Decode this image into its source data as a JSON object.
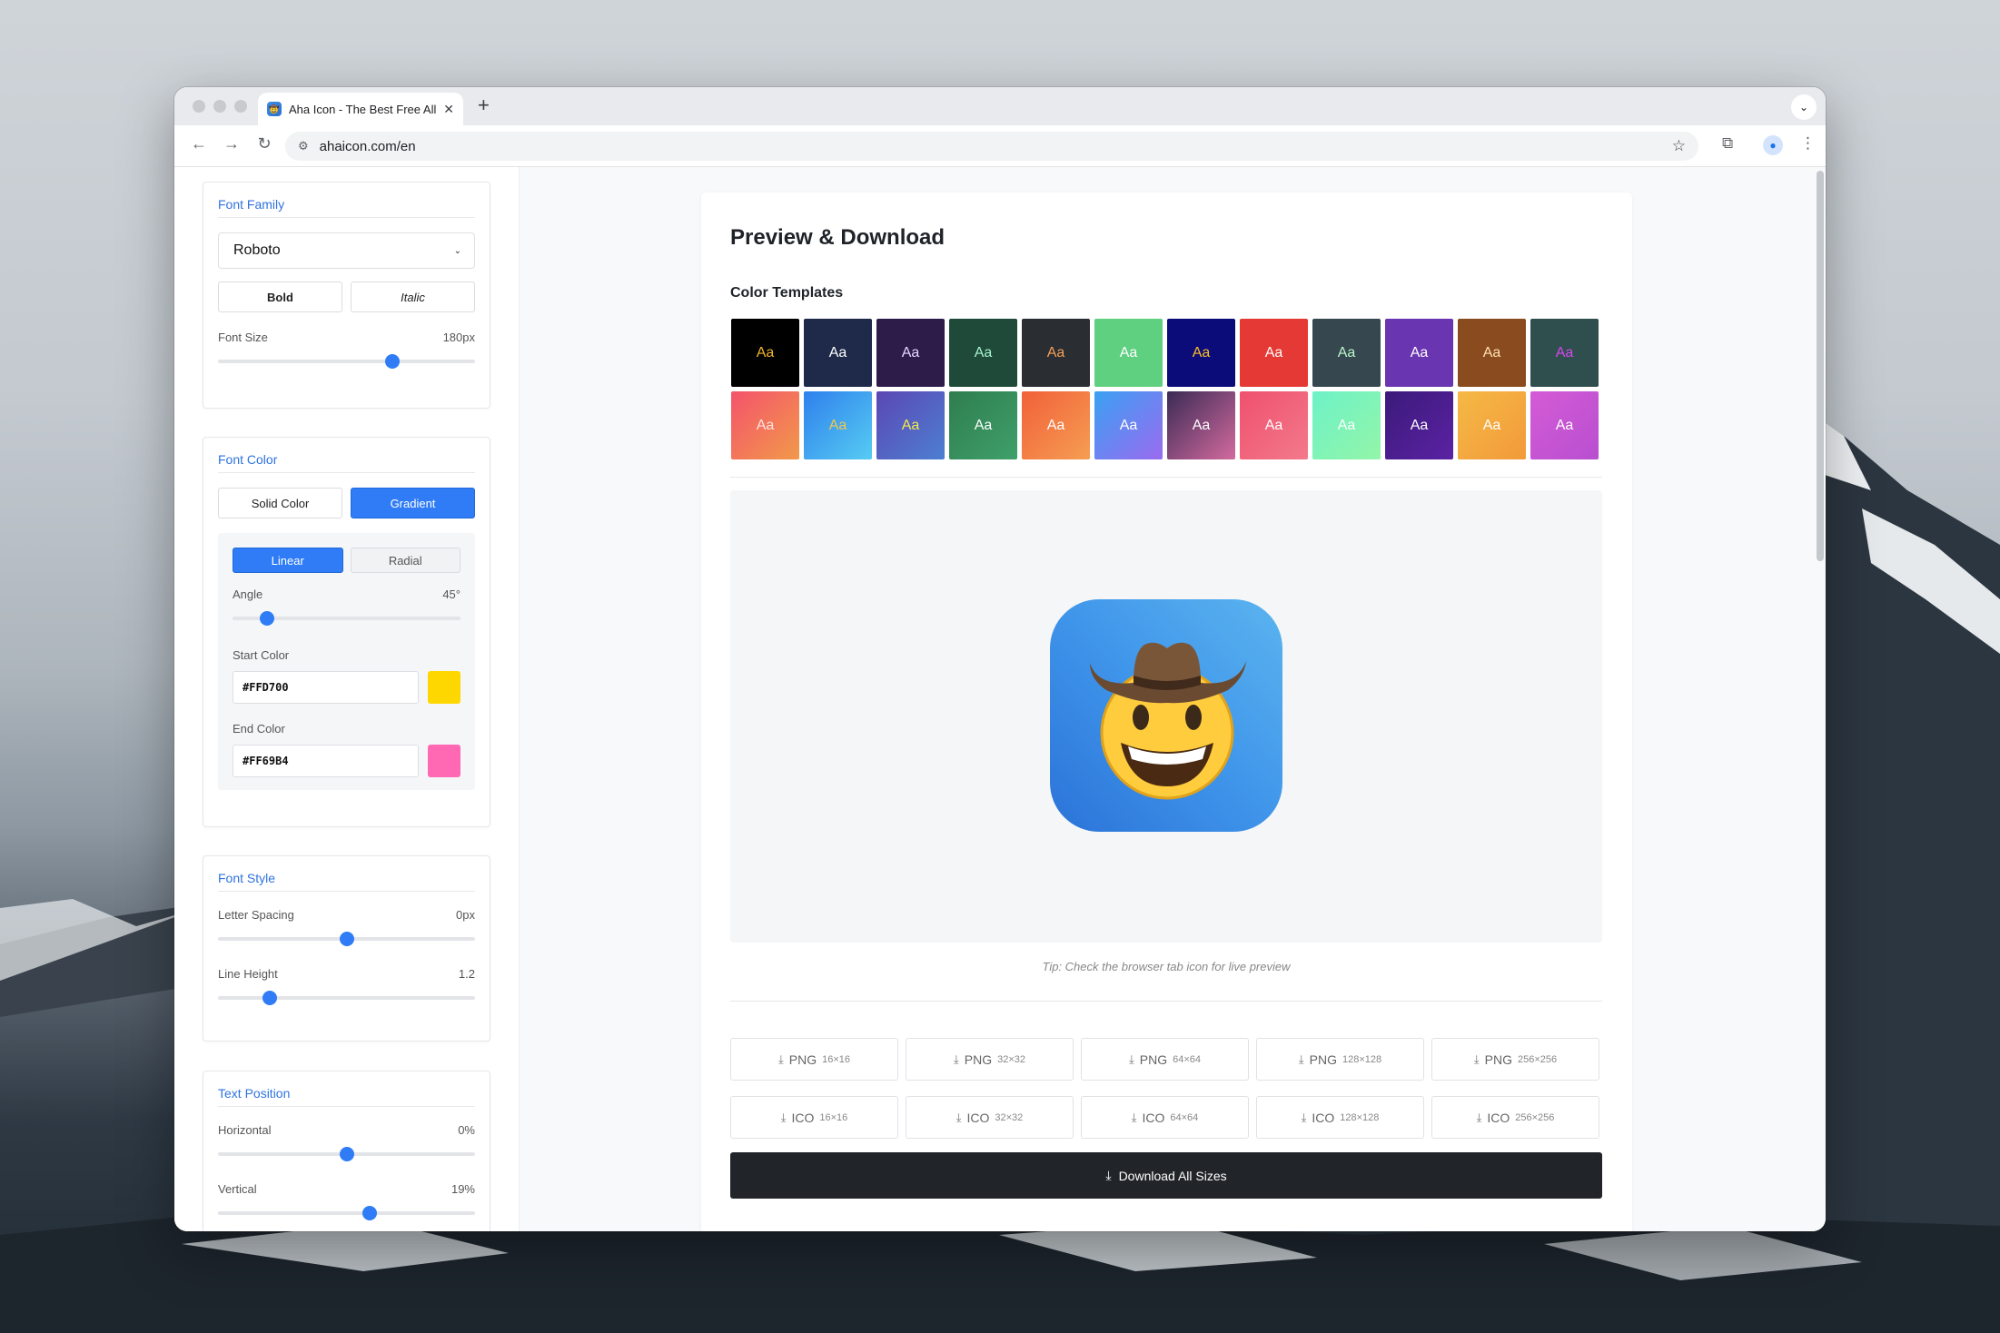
{
  "browser": {
    "tab_title": "Aha Icon - The Best Free All-in-One Icon Generator",
    "url": "ahaicon.com/en"
  },
  "sidebar": {
    "font_family": {
      "title": "Font Family",
      "selected": "Roboto",
      "bold_label": "Bold",
      "italic_label": "Italic",
      "font_size_label": "Font Size",
      "font_size_value": "180px",
      "font_size_fraction": 0.68
    },
    "font_color": {
      "title": "Font Color",
      "solid_label": "Solid Color",
      "gradient_label": "Gradient",
      "linear_label": "Linear",
      "radial_label": "Radial",
      "angle_label": "Angle",
      "angle_value": "45°",
      "angle_fraction": 0.15,
      "start_color_label": "Start Color",
      "start_color_value": "#FFD700",
      "end_color_label": "End Color",
      "end_color_value": "#FF69B4"
    },
    "font_style": {
      "title": "Font Style",
      "letter_spacing_label": "Letter Spacing",
      "letter_spacing_value": "0px",
      "letter_spacing_fraction": 0.5,
      "line_height_label": "Line Height",
      "line_height_value": "1.2",
      "line_height_fraction": 0.2
    },
    "text_position": {
      "title": "Text Position",
      "horizontal_label": "Horizontal",
      "horizontal_value": "0%",
      "horizontal_fraction": 0.5,
      "vertical_label": "Vertical",
      "vertical_value": "19%",
      "vertical_fraction": 0.59
    }
  },
  "main": {
    "title": "Preview & Download",
    "color_templates_title": "Color Templates",
    "template_label": "Aa",
    "templates": [
      {
        "bg": "#000000",
        "fg": "#f0b429"
      },
      {
        "bg": "#1f2a4a",
        "fg": "#ffffff"
      },
      {
        "bg": "#2d1b4a",
        "fg": "#e9d5ff"
      },
      {
        "bg": "#1f4a3a",
        "fg": "#a7f3d0"
      },
      {
        "bg": "#2a2d31",
        "fg": "#f5a05a"
      },
      {
        "bg": "#5fcf80",
        "fg": "#ffffff"
      },
      {
        "bg": "#0b0b7a",
        "fg": "#fbbf24"
      },
      {
        "bg": "#e53935",
        "fg": "#ffffff"
      },
      {
        "bg": "#37474f",
        "fg": "#b9f6ca"
      },
      {
        "bg": "#6a35b0",
        "fg": "#ffffff"
      },
      {
        "bg": "#8a4b1f",
        "fg": "#ffe0b2"
      },
      {
        "bg": "#2f4f4f",
        "fg": "#d946ef"
      },
      {
        "bg": "linear-gradient(135deg,#f4536b,#f2994a)",
        "fg": "#ffe4e4"
      },
      {
        "bg": "linear-gradient(135deg,#2f80ed,#56ccf2)",
        "fg": "#f2c94c"
      },
      {
        "bg": "linear-gradient(135deg,#5b47b5,#4d7fd1)",
        "fg": "#f2e94c"
      },
      {
        "bg": "linear-gradient(135deg,#2f7d4f,#3fa06a)",
        "fg": "#ffffff"
      },
      {
        "bg": "linear-gradient(135deg,#f2603a,#f59e52)",
        "fg": "#ffffff"
      },
      {
        "bg": "linear-gradient(135deg,#3aa0f2,#9b6bf0)",
        "fg": "#ffffff"
      },
      {
        "bg": "linear-gradient(135deg,#3b2b55,#d36a9e)",
        "fg": "#ffffff"
      },
      {
        "bg": "linear-gradient(135deg,#f0506e,#f27a8a)",
        "fg": "#ffffff"
      },
      {
        "bg": "linear-gradient(135deg,#6df2c7,#93f5a8)",
        "fg": "#ffffff"
      },
      {
        "bg": "linear-gradient(135deg,#3b1a7a,#5b22a3)",
        "fg": "#ffffff"
      },
      {
        "bg": "linear-gradient(135deg,#f5b945,#f29a3a)",
        "fg": "#ffffff"
      },
      {
        "bg": "linear-gradient(135deg,#d45bd6,#b84fd0)",
        "fg": "#ffffff"
      }
    ],
    "preview_icon": "cowboy-hat-face-emoji",
    "tip": "Tip: Check the browser tab icon for live preview",
    "downloads": [
      {
        "format": "PNG",
        "size": "16×16"
      },
      {
        "format": "PNG",
        "size": "32×32"
      },
      {
        "format": "PNG",
        "size": "64×64"
      },
      {
        "format": "PNG",
        "size": "128×128"
      },
      {
        "format": "PNG",
        "size": "256×256"
      },
      {
        "format": "ICO",
        "size": "16×16"
      },
      {
        "format": "ICO",
        "size": "32×32"
      },
      {
        "format": "ICO",
        "size": "64×64"
      },
      {
        "format": "ICO",
        "size": "128×128"
      },
      {
        "format": "ICO",
        "size": "256×256"
      }
    ],
    "download_all_label": "Download All Sizes"
  },
  "colors": {
    "accent": "#2f7cf6",
    "title_blue": "#2f73e0",
    "dark_button": "#212529"
  }
}
